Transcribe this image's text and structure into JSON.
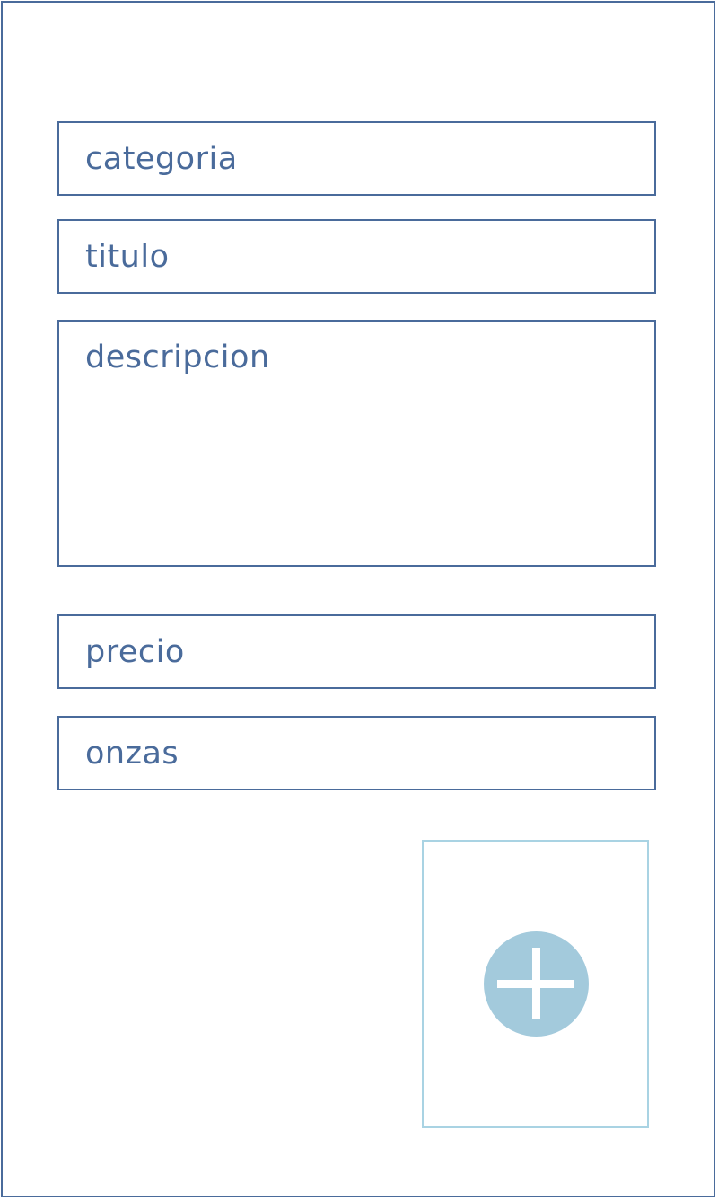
{
  "form": {
    "fields": [
      {
        "key": "categoria",
        "placeholder": "categoria"
      },
      {
        "key": "titulo",
        "placeholder": "titulo"
      },
      {
        "key": "descripcion",
        "placeholder": "descripcion"
      },
      {
        "key": "precio",
        "placeholder": "precio"
      },
      {
        "key": "onzas",
        "placeholder": "onzas"
      }
    ],
    "add_image": {
      "icon": "plus-icon"
    }
  },
  "colors": {
    "border": "#4a6b9b",
    "text": "#4a6b9b",
    "accent_border": "#a9d3e3",
    "accent_fill": "#a3cadc"
  }
}
